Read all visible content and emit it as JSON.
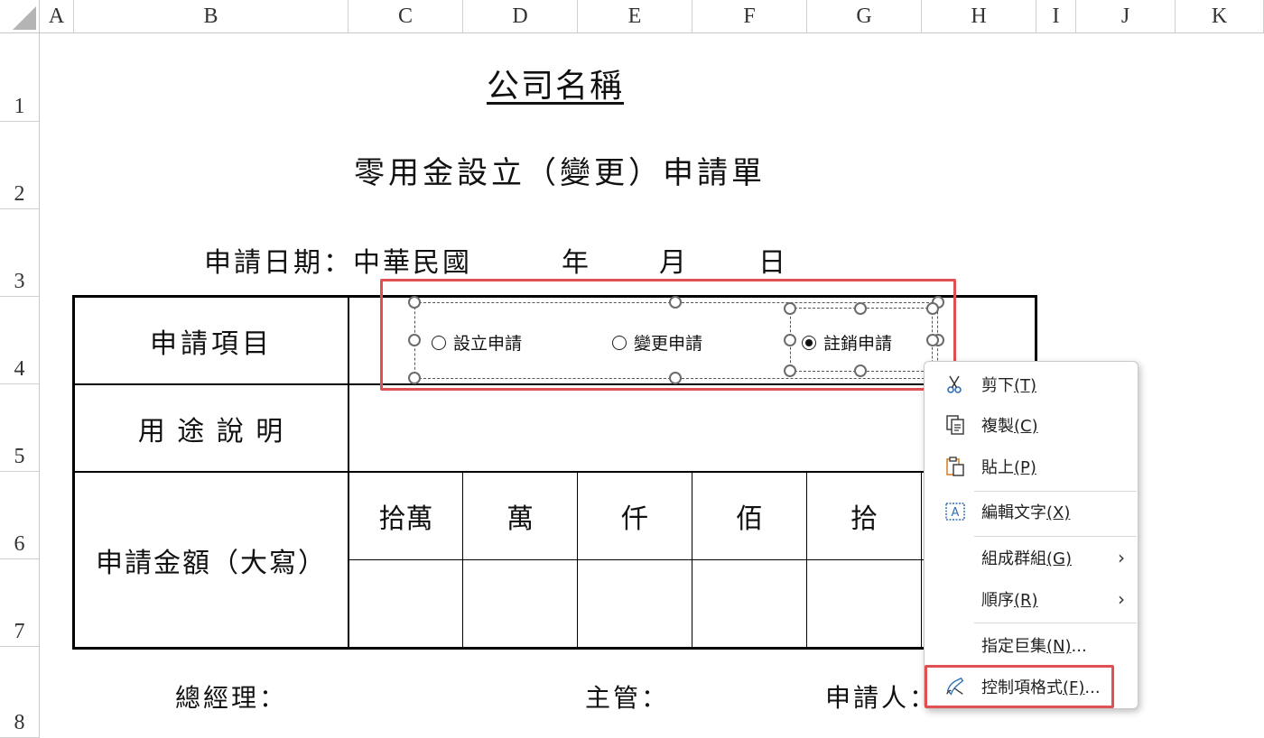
{
  "columns": [
    "A",
    "B",
    "C",
    "D",
    "E",
    "F",
    "G",
    "H",
    "I",
    "J",
    "K"
  ],
  "rows": [
    "1",
    "2",
    "3",
    "4",
    "5",
    "6",
    "7",
    "8"
  ],
  "sheet": {
    "company_title": "公司名稱",
    "form_title": "零用金設立（變更）申請單",
    "date_line": {
      "label": "申請日期：中華民國",
      "year": "年",
      "month": "月",
      "day": "日"
    },
    "table": {
      "row_apply_item": "申請項目",
      "row_purpose": "用 途 說 明",
      "row_amount": "申請金額（大寫）",
      "units": [
        "拾萬",
        "萬",
        "仟",
        "佰",
        "拾"
      ]
    },
    "signatures": {
      "gm": "總經理：",
      "supervisor": "主管：",
      "applicant": "申請人："
    }
  },
  "radio_options": [
    {
      "label": "設立申請",
      "selected": false
    },
    {
      "label": "變更申請",
      "selected": false
    },
    {
      "label": "註銷申請",
      "selected": true
    }
  ],
  "context_menu": {
    "items": [
      {
        "label": "剪下",
        "key": "(T)",
        "icon": "scissors-icon"
      },
      {
        "label": "複製",
        "key": "(C)",
        "icon": "copy-icon"
      },
      {
        "label": "貼上",
        "key": "(P)",
        "icon": "paste-icon"
      },
      {
        "label": "編輯文字",
        "key": "(X)",
        "icon": "edit-text-icon"
      },
      {
        "label": "組成群組",
        "key": "(G)",
        "has_submenu": true
      },
      {
        "label": "順序",
        "key": "(R)",
        "has_submenu": true
      },
      {
        "label": "指定巨集",
        "key": "(N)",
        "suffix": "..."
      },
      {
        "label": "控制項格式",
        "key": "(F)",
        "suffix": "...",
        "icon": "format-control-icon",
        "highlighted": true
      }
    ]
  },
  "colors": {
    "highlight_border": "#e05050",
    "header_text": "#333333",
    "icon_blue": "#2f6fb5",
    "icon_orange": "#d9822b"
  }
}
